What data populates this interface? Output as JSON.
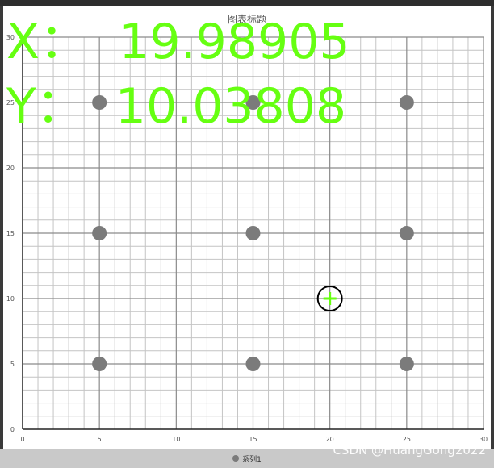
{
  "chart_data": {
    "type": "scatter",
    "title": "图表标题",
    "xlim": [
      0,
      30
    ],
    "ylim": [
      0,
      30
    ],
    "x_ticks": [
      0,
      5,
      10,
      15,
      20,
      25,
      30
    ],
    "y_ticks": [
      0,
      5,
      10,
      15,
      20,
      25,
      30
    ],
    "grid": "major and minor",
    "legend_position": "bottom",
    "series": [
      {
        "name": "系列1",
        "color": "#7b7b7b",
        "points": [
          {
            "x": 5,
            "y": 5
          },
          {
            "x": 15,
            "y": 5
          },
          {
            "x": 25,
            "y": 5
          },
          {
            "x": 5,
            "y": 15
          },
          {
            "x": 15,
            "y": 15
          },
          {
            "x": 25,
            "y": 15
          },
          {
            "x": 5,
            "y": 25
          },
          {
            "x": 15,
            "y": 25
          },
          {
            "x": 25,
            "y": 25
          }
        ]
      }
    ],
    "cursor": {
      "x": 20,
      "y": 10
    }
  },
  "readout": {
    "x_text": "X：  19.98905",
    "y_text": "Y：  10.03808",
    "color": "#66ff11"
  },
  "legend": {
    "label": "系列1"
  },
  "watermark": "CSDN @HuangGong2022"
}
